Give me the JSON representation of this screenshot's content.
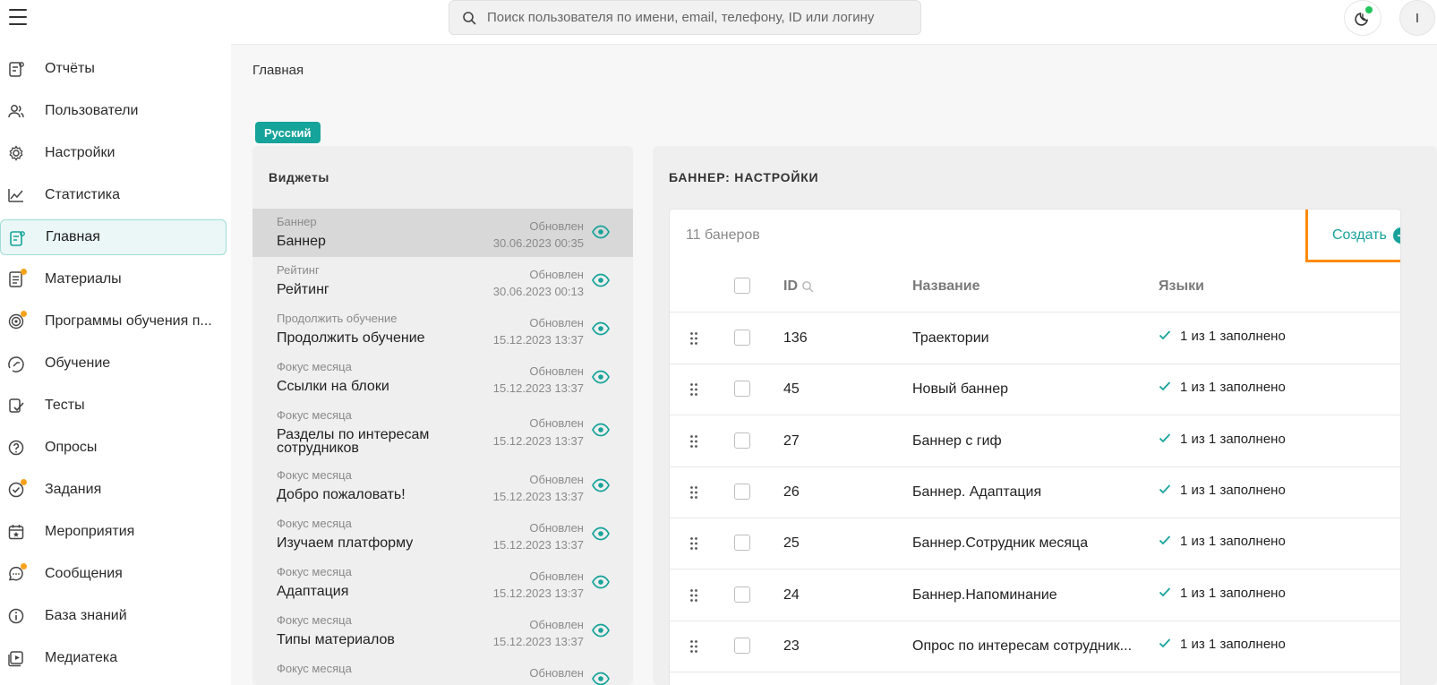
{
  "search": {
    "placeholder": "Поиск пользователя по имени, email, телефону, ID или логину"
  },
  "avatar": {
    "initial": "I"
  },
  "sidebar": {
    "items": [
      {
        "label": "Отчёты",
        "icon": "report-icon"
      },
      {
        "label": "Пользователи",
        "icon": "users-icon"
      },
      {
        "label": "Настройки",
        "icon": "gear-icon"
      },
      {
        "label": "Статистика",
        "icon": "chart-line-icon"
      },
      {
        "label": "Главная",
        "icon": "home-dashboard-icon",
        "active": true
      },
      {
        "label": "Материалы",
        "icon": "document-icon",
        "badge": true
      },
      {
        "label": "Программы обучения п...",
        "icon": "target-icon",
        "badge": true
      },
      {
        "label": "Обучение",
        "icon": "learning-icon"
      },
      {
        "label": "Тесты",
        "icon": "test-checklist-icon"
      },
      {
        "label": "Опросы",
        "icon": "question-icon"
      },
      {
        "label": "Задания",
        "icon": "task-icon",
        "badge": true
      },
      {
        "label": "Мероприятия",
        "icon": "calendar-icon"
      },
      {
        "label": "Сообщения",
        "icon": "chat-icon",
        "badge": true
      },
      {
        "label": "База знаний",
        "icon": "info-icon"
      },
      {
        "label": "Медиатека",
        "icon": "media-icon"
      }
    ]
  },
  "breadcrumb": "Главная",
  "language_chip": "Русский",
  "widgets": {
    "title": "Виджеты",
    "updated_label": "Обновлен",
    "items": [
      {
        "type": "Баннер",
        "name": "Баннер",
        "date": "30.06.2023 00:35",
        "selected": true
      },
      {
        "type": "Рейтинг",
        "name": "Рейтинг",
        "date": "30.06.2023 00:13"
      },
      {
        "type": "Продолжить обучение",
        "name": "Продолжить обучение",
        "date": "15.12.2023 13:37"
      },
      {
        "type": "Фокус месяца",
        "name": "Ссылки на блоки",
        "date": "15.12.2023 13:37"
      },
      {
        "type": "Фокус месяца",
        "name": "Разделы по интересам сотрудников",
        "date": "15.12.2023 13:37",
        "tall": true
      },
      {
        "type": "Фокус месяца",
        "name": "Добро пожаловать!",
        "date": "15.12.2023 13:37"
      },
      {
        "type": "Фокус месяца",
        "name": "Изучаем платформу",
        "date": "15.12.2023 13:37"
      },
      {
        "type": "Фокус месяца",
        "name": "Адаптация",
        "date": "15.12.2023 13:37"
      },
      {
        "type": "Фокус месяца",
        "name": "Типы материалов",
        "date": "15.12.2023 13:37"
      },
      {
        "type": "Фокус месяца",
        "name": "",
        "date": "",
        "partial": true
      }
    ]
  },
  "banner": {
    "title": "БАННЕР: НАСТРОЙКИ",
    "count": "11 банеров",
    "create_label": "Создать",
    "columns": {
      "id": "ID",
      "name": "Название",
      "languages": "Языки"
    },
    "rows": [
      {
        "id": "136",
        "name": "Траектории",
        "languages": "1 из 1 заполнено",
        "status": "green"
      },
      {
        "id": "45",
        "name": "Новый баннер",
        "languages": "1 из 1 заполнено",
        "status": "grey"
      },
      {
        "id": "27",
        "name": "Баннер с гиф",
        "languages": "1 из 1 заполнено",
        "status": "green"
      },
      {
        "id": "26",
        "name": "Баннер. Адаптация",
        "languages": "1 из 1 заполнено",
        "status": "green"
      },
      {
        "id": "25",
        "name": "Баннер.Сотрудник месяца",
        "languages": "1 из 1 заполнено",
        "status": "green"
      },
      {
        "id": "24",
        "name": "Баннер.Напоминание",
        "languages": "1 из 1 заполнено",
        "status": "green"
      },
      {
        "id": "23",
        "name": "Опрос по интересам сотрудник...",
        "languages": "1 из 1 заполнено",
        "status": "green"
      }
    ]
  },
  "colors": {
    "accent": "#16a39a",
    "highlight": "#ff8a00",
    "badge": "#f7a21b",
    "online": "#22c55e"
  }
}
